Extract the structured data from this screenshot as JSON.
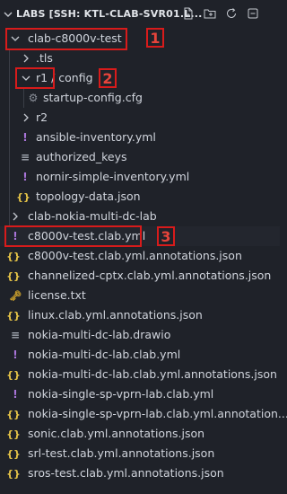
{
  "header": {
    "title": "LABS [SSH: KTL-CLAB-SVR01.L...",
    "actions": [
      "new-file-icon",
      "new-folder-icon",
      "refresh-icon",
      "collapse-all-icon"
    ]
  },
  "tree": {
    "clab_folder": "clab-c8000v-test",
    "tls_folder": ".tls",
    "r1_folder": "r1 / config",
    "startup_config": "startup-config.cfg",
    "r2_folder": "r2",
    "ansible_inventory": "ansible-inventory.yml",
    "authorized_keys": "authorized_keys",
    "nornir_inventory": "nornir-simple-inventory.yml",
    "topology_data": "topology-data.json",
    "nokia_folder": "clab-nokia-multi-dc-lab",
    "c8000v_clab": "c8000v-test.clab.yml",
    "files": [
      {
        "name": "c8000v-test.clab.yml.annotations.json",
        "icon": "json"
      },
      {
        "name": "channelized-cptx.clab.yml.annotations.json",
        "icon": "json"
      },
      {
        "name": "license.txt",
        "icon": "key"
      },
      {
        "name": "linux.clab.yml.annotations.json",
        "icon": "json"
      },
      {
        "name": "nokia-multi-dc-lab.drawio",
        "icon": "lines"
      },
      {
        "name": "nokia-multi-dc-lab.clab.yml",
        "icon": "yaml"
      },
      {
        "name": "nokia-multi-dc-lab.clab.yml.annotations.json",
        "icon": "json"
      },
      {
        "name": "nokia-single-sp-vprn-lab.clab.yml",
        "icon": "yaml"
      },
      {
        "name": "nokia-single-sp-vprn-lab.clab.yml.annotation...",
        "icon": "json"
      },
      {
        "name": "sonic.clab.yml.annotations.json",
        "icon": "json"
      },
      {
        "name": "srl-test.clab.yml.annotations.json",
        "icon": "json"
      },
      {
        "name": "sros-test.clab.yml.annotations.json",
        "icon": "json"
      }
    ]
  },
  "annotations": {
    "badge_1": "1",
    "badge_2": "2",
    "badge_3": "3",
    "highlight_color": "#d81b1b"
  }
}
